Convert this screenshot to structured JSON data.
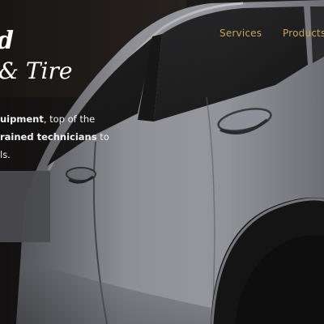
{
  "nav": {
    "items": [
      {
        "label": "Services"
      },
      {
        "label": "Products"
      }
    ]
  },
  "hero": {
    "brand_line1": "d",
    "brand_line2": "& Tire",
    "tagline": {
      "p1": "uipment",
      "p2": ", top of the",
      "p3": "rained technicians",
      "p4": " to",
      "p5": "ls."
    }
  },
  "colors": {
    "accent": "#c9a35d",
    "text": "#ffffff",
    "cta_box": "#4a4b4f"
  }
}
